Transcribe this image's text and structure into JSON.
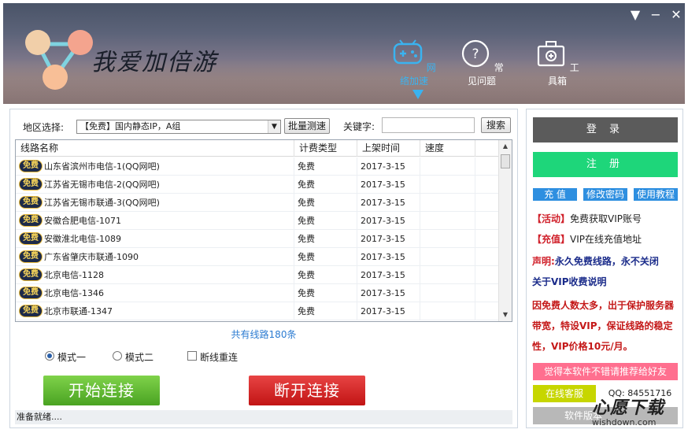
{
  "window": {
    "min_label": "−",
    "close_label": "✕",
    "menu_label": "▼"
  },
  "app": {
    "title": "我爱加倍游"
  },
  "nav": [
    {
      "label": "网络加速",
      "icon": "gamepad-icon",
      "active": true
    },
    {
      "label": "常见问题",
      "icon": "question-icon",
      "active": false
    },
    {
      "label": "工具箱",
      "icon": "toolbox-icon",
      "active": false
    }
  ],
  "filter": {
    "region_label": "地区选择:",
    "region_value": "【免费】国内静态IP，A组",
    "batch_test_label": "批量测速",
    "keyword_label": "关键字:",
    "keyword_value": "",
    "search_label": "搜索"
  },
  "table": {
    "headers": [
      "线路名称",
      "计费类型",
      "上架时间",
      "速度"
    ],
    "rows": [
      {
        "badge": "免费",
        "name": "山东省滨州市电信-1(QQ网吧)",
        "type": "免费",
        "date": "2017-3-15",
        "speed": ""
      },
      {
        "badge": "免费",
        "name": "江苏省无锡市电信-2(QQ网吧)",
        "type": "免费",
        "date": "2017-3-15",
        "speed": ""
      },
      {
        "badge": "免费",
        "name": "江苏省无锡市联通-3(QQ网吧)",
        "type": "免费",
        "date": "2017-3-15",
        "speed": ""
      },
      {
        "badge": "免费",
        "name": "安徽合肥电信-1071",
        "type": "免费",
        "date": "2017-3-15",
        "speed": ""
      },
      {
        "badge": "免费",
        "name": "安徽淮北电信-1089",
        "type": "免费",
        "date": "2017-3-15",
        "speed": ""
      },
      {
        "badge": "免费",
        "name": "广东省肇庆市联通-1090",
        "type": "免费",
        "date": "2017-3-15",
        "speed": ""
      },
      {
        "badge": "免费",
        "name": "北京电信-1128",
        "type": "免费",
        "date": "2017-3-15",
        "speed": ""
      },
      {
        "badge": "免费",
        "name": "北京电信-1346",
        "type": "免费",
        "date": "2017-3-15",
        "speed": ""
      },
      {
        "badge": "免费",
        "name": "北京市联通-1347",
        "type": "免费",
        "date": "2017-3-15",
        "speed": ""
      }
    ]
  },
  "total_label": "共有线路180条",
  "options": {
    "mode1": "模式一",
    "mode2": "模式二",
    "reconnect": "断线重连",
    "mode_selected": "mode1",
    "reconnect_checked": false
  },
  "actions": {
    "connect": "开始连接",
    "disconnect": "断开连接"
  },
  "status": "准备就绪....",
  "side": {
    "login": "登 录",
    "register": "注 册",
    "recharge": "充 值",
    "change_password": "修改密码",
    "tutorial": "使用教程",
    "activity_tag": "【活动】",
    "activity_text": "免费获取VIP账号",
    "recharge_tag": "【充值】",
    "recharge_text": "VIP在线充值地址",
    "statement_label": "声明:",
    "statement_text": "永久免费线路，永不关闭",
    "vip_notice": "关于VIP收费说明",
    "notice": "因免费人数太多，出于保护服务器带宽，特设VIP，保证线路的稳定性，VIP价格10元/月。",
    "share": "觉得本软件不错请推荐给好友",
    "customer_service": "在线客服",
    "qq": "QQ: 84551716",
    "version": "软件版本"
  },
  "watermark": {
    "brand": "心愿下载",
    "url": "wishdown.com"
  },
  "colors": {
    "accent_blue": "#3ab3f0",
    "login": "#5b5b5b",
    "register": "#1ed67a",
    "connect": "#59b52e",
    "disconnect": "#d21f1f"
  }
}
